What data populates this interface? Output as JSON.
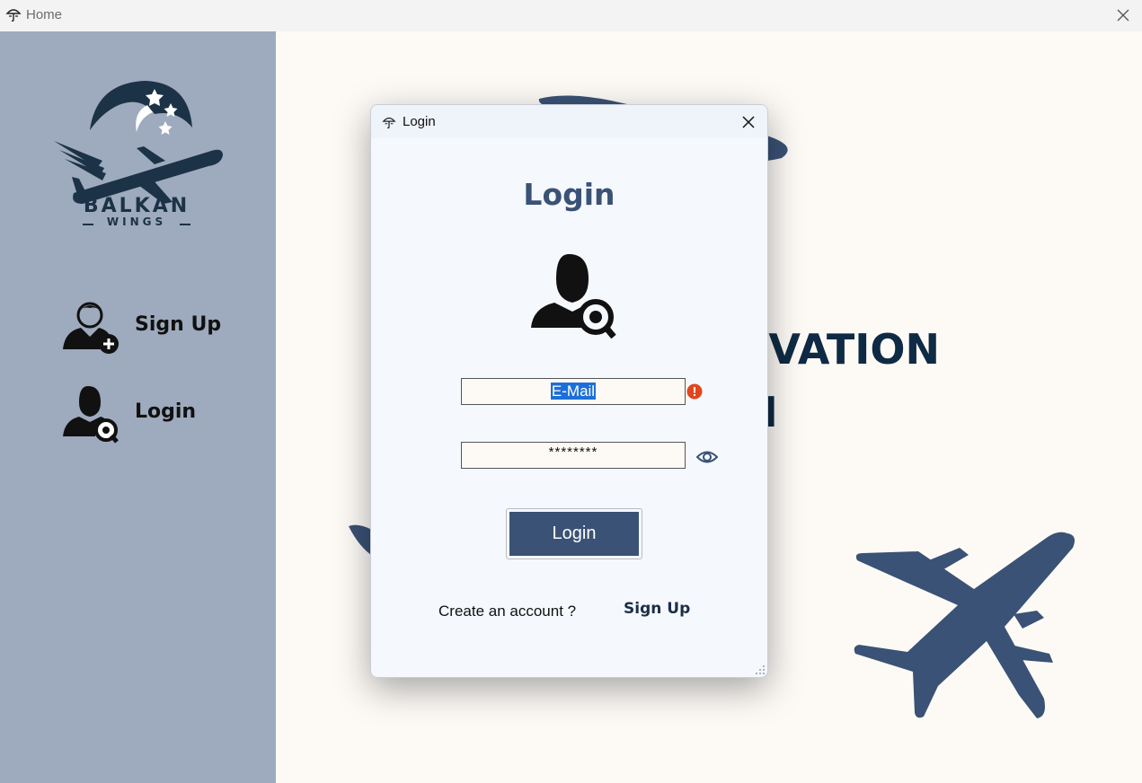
{
  "window": {
    "title": "Home",
    "app_icon": "umbrella-app-icon",
    "close_icon": "close-icon"
  },
  "sidebar": {
    "logo": {
      "brand": "BALKAN",
      "sub": "WINGS"
    },
    "items": [
      {
        "label": "Sign Up",
        "icon": "add-user-icon"
      },
      {
        "label": "Login",
        "icon": "user-search-icon"
      }
    ]
  },
  "background": {
    "headline_line1": "RVATION",
    "headline_line2": "M"
  },
  "dialog": {
    "title": "Login",
    "heading": "Login",
    "email_value": "E-Mail",
    "password_value": "********",
    "login_button": "Login",
    "create_account_text": "Create an account ?",
    "signup_link": "Sign Up"
  },
  "colors": {
    "sidebar_bg": "#9eaabd",
    "accent": "#3a5275",
    "navy": "#1c3246",
    "page_bg": "#fdfaf6"
  }
}
